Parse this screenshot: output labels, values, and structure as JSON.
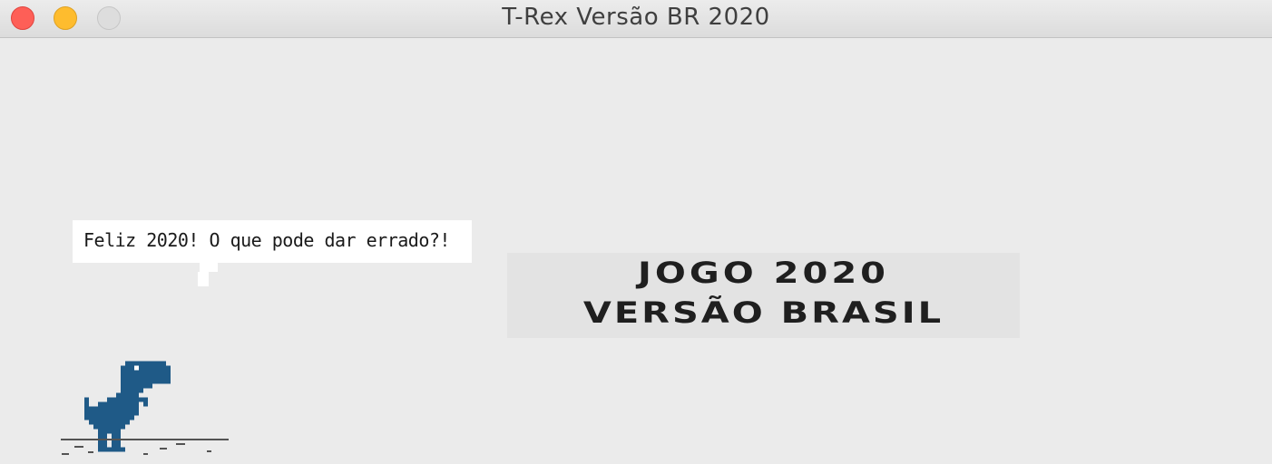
{
  "window": {
    "title": "T-Rex Versão BR 2020"
  },
  "speech_bubble": {
    "text": "Feliz 2020! O que pode dar errado?!"
  },
  "banner": {
    "line1": "JOGO 2020",
    "line2": "VERSÃO BRASIL"
  },
  "colors": {
    "dino": "#1f5a87",
    "ground": "#535353",
    "background": "#ebebeb"
  },
  "icons": {
    "player": "t-rex-dino-icon"
  }
}
